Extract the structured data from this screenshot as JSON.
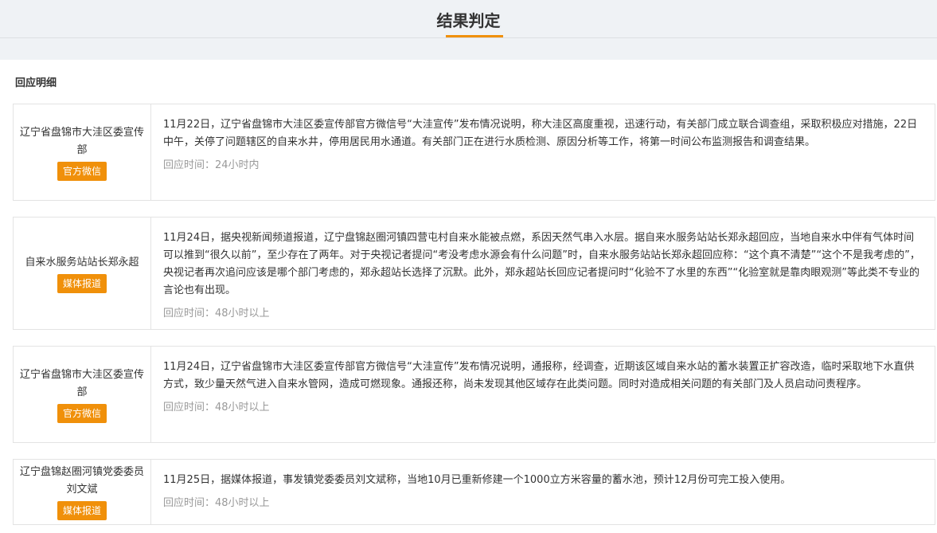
{
  "header": {
    "title": "结果判定"
  },
  "section": {
    "title": "回应明细"
  },
  "responses": [
    {
      "source": "辽宁省盘锦市大洼区委宣传部",
      "tag": "官方微信",
      "content": "11月22日，辽宁省盘锦市大洼区委宣传部官方微信号“大洼宣传”发布情况说明，称大洼区高度重视，迅速行动，有关部门成立联合调查组，采取积极应对措施，22日中午，关停了问题辖区的自来水井，停用居民用水通道。有关部门正在进行水质检测、原因分析等工作，将第一时间公布监测报告和调查结果。",
      "time": "回应时间：24小时内"
    },
    {
      "source": "自来水服务站站长郑永超",
      "tag": "媒体报道",
      "content": "11月24日，据央视新闻频道报道，辽宁盘锦赵圈河镇四营屯村自来水能被点燃，系因天然气串入水层。据自来水服务站站长郑永超回应，当地自来水中伴有气体时间可以推到“很久以前”，至少存在了两年。对于央视记者提问“考没考虑水源会有什么问题”时，自来水服务站站长郑永超回应称：“这个真不清楚”“这个不是我考虑的”，央视记者再次追问应该是哪个部门考虑的，郑永超站长选择了沉默。此外，郑永超站长回应记者提问时“化验不了水里的东西”“化验室就是靠肉眼观测”等此类不专业的言论也有出现。",
      "time": "回应时间：48小时以上"
    },
    {
      "source": "辽宁省盘锦市大洼区委宣传部",
      "tag": "官方微信",
      "content": "11月24日，辽宁省盘锦市大洼区委宣传部官方微信号“大洼宣传”发布情况说明，通报称，经调查，近期该区域自来水站的蓄水装置正扩容改造，临时采取地下水直供方式，致少量天然气进入自来水管网，造成可燃现象。通报还称，尚未发现其他区域存在此类问题。同时对造成相关问题的有关部门及人员启动问责程序。",
      "time": "回应时间：48小时以上"
    },
    {
      "source": "辽宁盘锦赵圈河镇党委委员刘文斌",
      "tag": "媒体报道",
      "content": "11月25日，据媒体报道，事发镇党委委员刘文斌称，当地10月已重新修建一个1000立方米容量的蓄水池，预计12月份可完工投入使用。",
      "time": "回应时间：48小时以上"
    }
  ],
  "colors": {
    "accent": "#f0900a",
    "header_bg": "#eff2f5",
    "muted_text": "#999999",
    "border": "#e3e3e3"
  }
}
